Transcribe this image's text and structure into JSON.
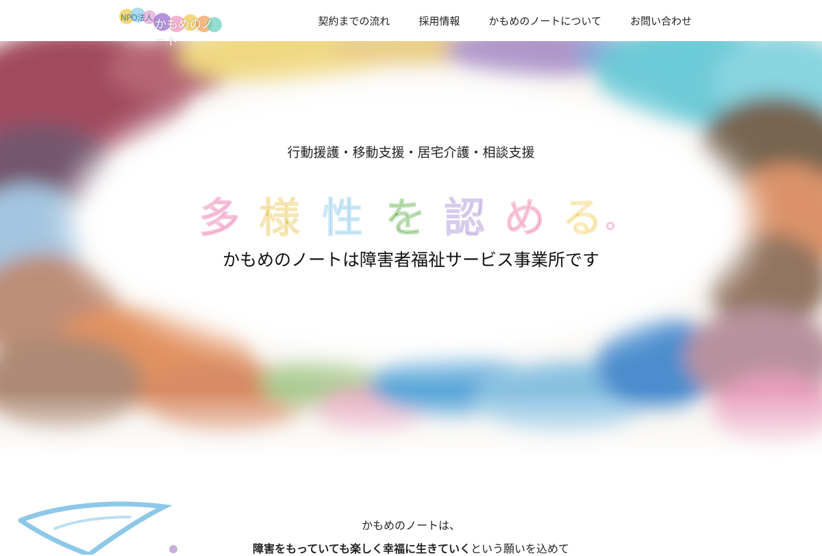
{
  "header": {
    "logo": {
      "prefix": "NPO法人",
      "name": "かもめのノート"
    },
    "nav": [
      {
        "label": "契約までの流れ"
      },
      {
        "label": "採用情報"
      },
      {
        "label": "かもめのノートについて"
      },
      {
        "label": "お問い合わせ"
      }
    ]
  },
  "hero": {
    "services": "行動援護・移動支援・居宅介護・相談支援",
    "headline_chars": [
      "多",
      "様",
      "性",
      "を",
      "認",
      "め",
      "る",
      "。"
    ],
    "headline_colors": [
      "#e86aa5",
      "#e8c34a",
      "#7fc4e8",
      "#5fb04a",
      "#9a7fd0",
      "#ef7da0",
      "#f0d060",
      "#e66f9e"
    ],
    "tagline": "かもめのノートは障害者福祉サービス事業所です"
  },
  "intro": {
    "line1": "かもめのノートは、",
    "line2_bold": "障害をもっていても楽しく幸福に生きていく",
    "line2_rest": "という願いを込めて"
  }
}
